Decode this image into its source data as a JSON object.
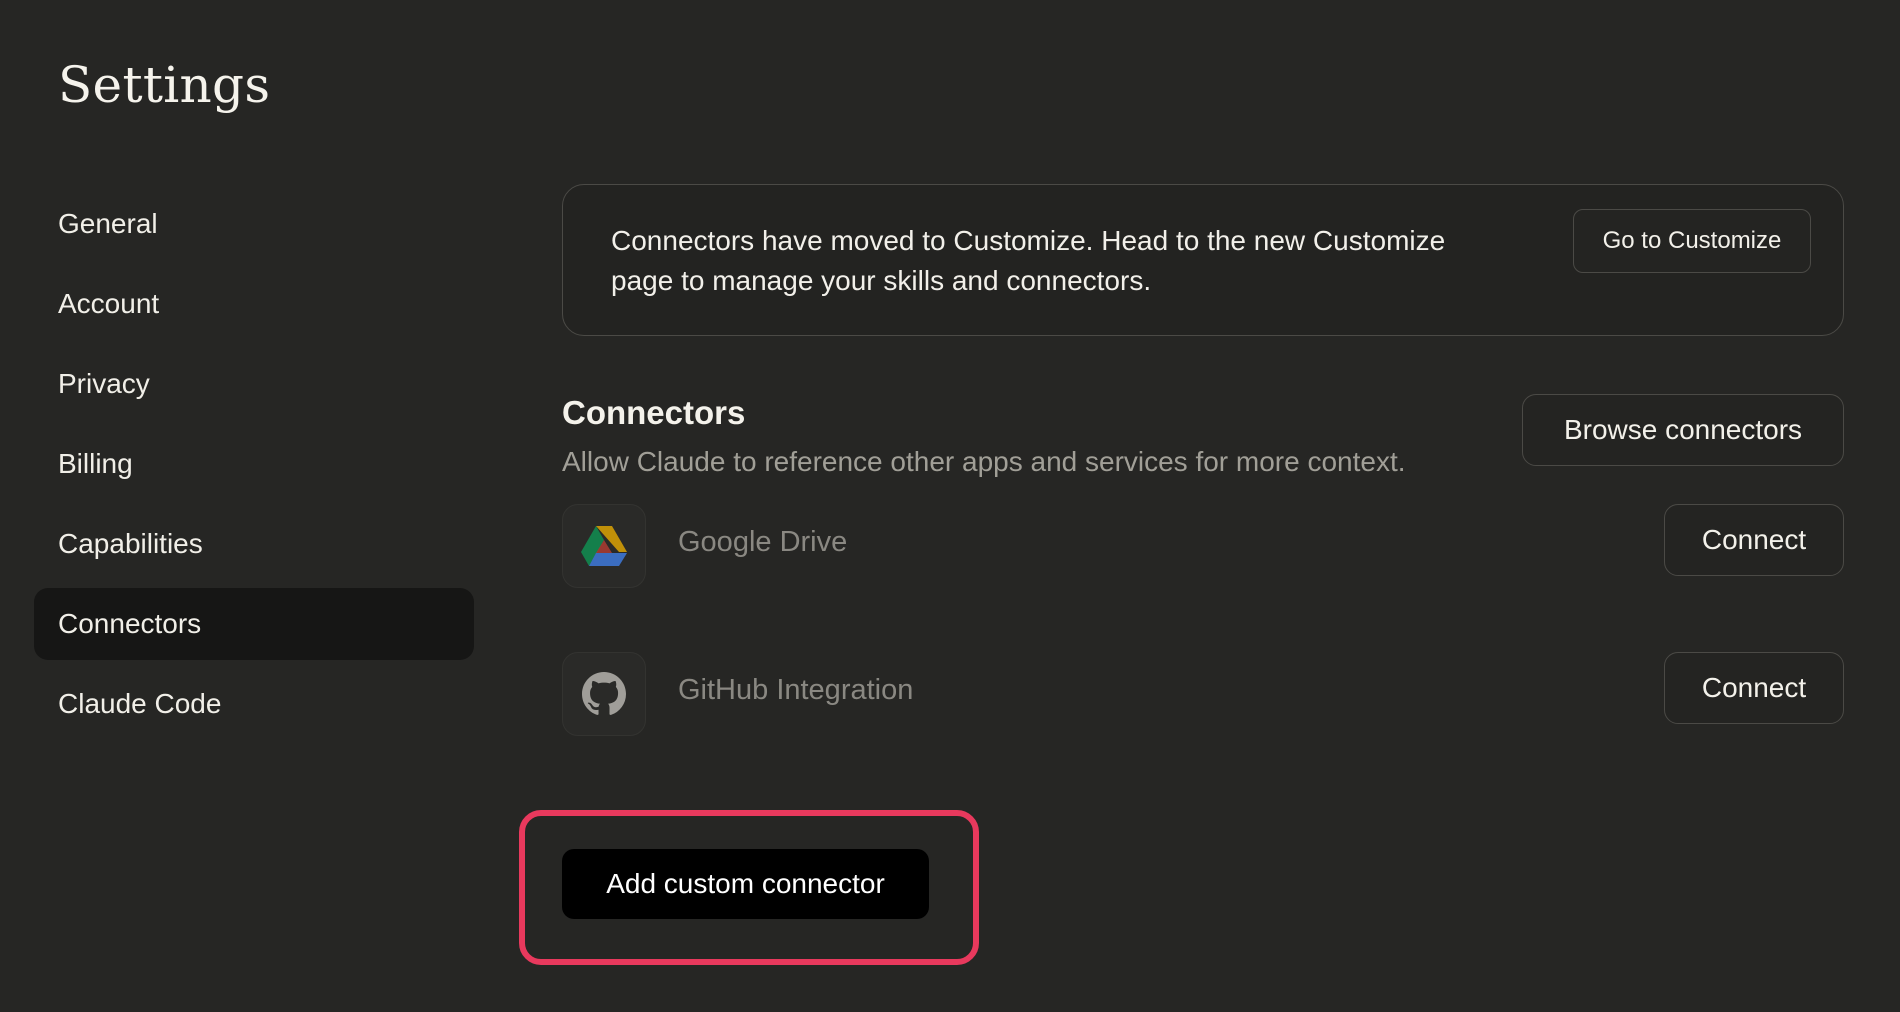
{
  "page": {
    "title": "Settings"
  },
  "sidebar": {
    "items": [
      {
        "label": "General",
        "active": false
      },
      {
        "label": "Account",
        "active": false
      },
      {
        "label": "Privacy",
        "active": false
      },
      {
        "label": "Billing",
        "active": false
      },
      {
        "label": "Capabilities",
        "active": false
      },
      {
        "label": "Connectors",
        "active": true
      },
      {
        "label": "Claude Code",
        "active": false
      }
    ]
  },
  "notice": {
    "text": "Connectors have moved to Customize. Head to the new Customize page to manage your skills and connectors.",
    "button_label": "Go to Customize"
  },
  "connectors_section": {
    "title": "Connectors",
    "description": "Allow Claude to reference other apps and services for more context.",
    "browse_button_label": "Browse connectors",
    "items": [
      {
        "name": "Google Drive",
        "icon": "google-drive-icon",
        "button_label": "Connect"
      },
      {
        "name": "GitHub Integration",
        "icon": "github-icon",
        "button_label": "Connect"
      }
    ],
    "add_custom_label": "Add custom connector"
  },
  "colors": {
    "background": "#262624",
    "active_nav": "#161615",
    "highlight": "#e8395d",
    "primary_button": "#000000"
  }
}
